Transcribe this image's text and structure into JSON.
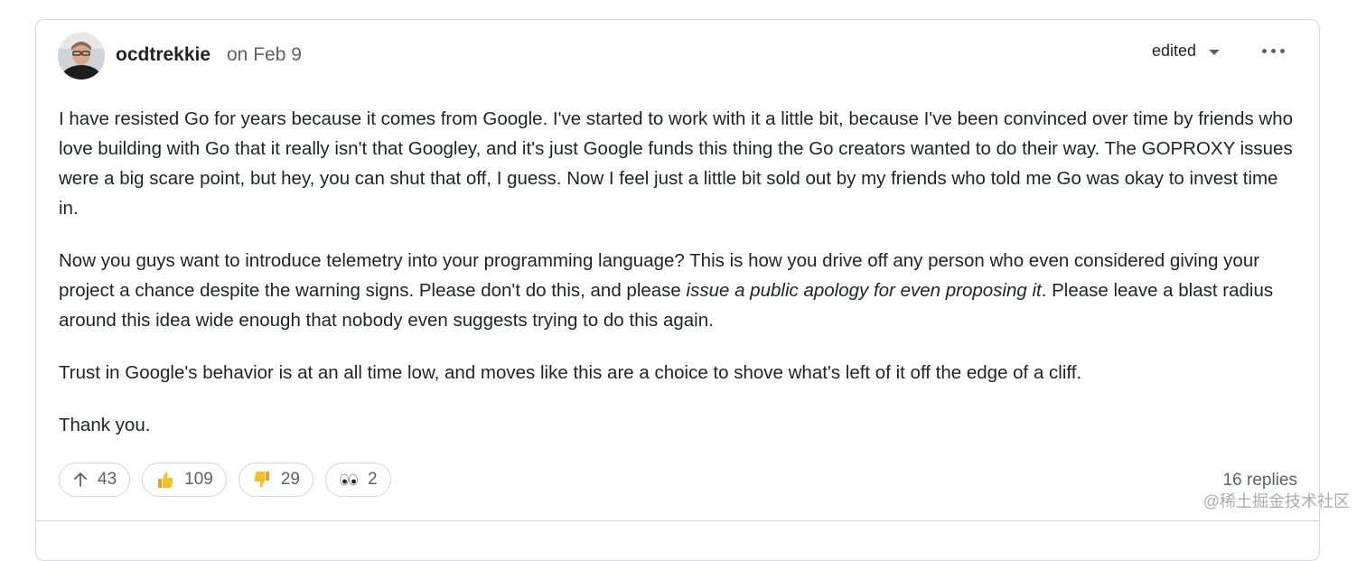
{
  "comment": {
    "author": "ocdtrekkie",
    "date": "on Feb 9",
    "edited_label": "edited",
    "paragraphs": {
      "p1": "I have resisted Go for years because it comes from Google. I've started to work with it a little bit, because I've been convinced over time by friends who love building with Go that it really isn't that Googley, and it's just Google funds this thing the Go creators wanted to do their way. The GOPROXY issues were a big scare point, but hey, you can shut that off, I guess. Now I feel just a little bit sold out by my friends who told me Go was okay to invest time in.",
      "p2_before": "Now you guys want to introduce telemetry into your programming language? This is how you drive off any person who even considered giving your project a chance despite the warning signs. Please don't do this, and please ",
      "p2_italic": "issue a public apology for even proposing it",
      "p2_after": ". Please leave a blast radius around this idea wide enough that nobody even suggests trying to do this again.",
      "p3": "Trust in Google's behavior is at an all time low, and moves like this are a choice to shove what's left of it off the edge of a cliff.",
      "p4": "Thank you."
    },
    "reactions": [
      {
        "icon": "upvote-arrow-icon",
        "count": "43"
      },
      {
        "icon": "thumbs-up-icon",
        "count": "109"
      },
      {
        "icon": "thumbs-down-icon",
        "count": "29"
      },
      {
        "icon": "eyes-icon",
        "count": "2"
      }
    ],
    "replies_label": "16 replies"
  },
  "watermark": "@稀土掘金技术社区",
  "colors": {
    "border": "#d0d7de",
    "text": "#1f2328",
    "muted": "#59636e"
  }
}
